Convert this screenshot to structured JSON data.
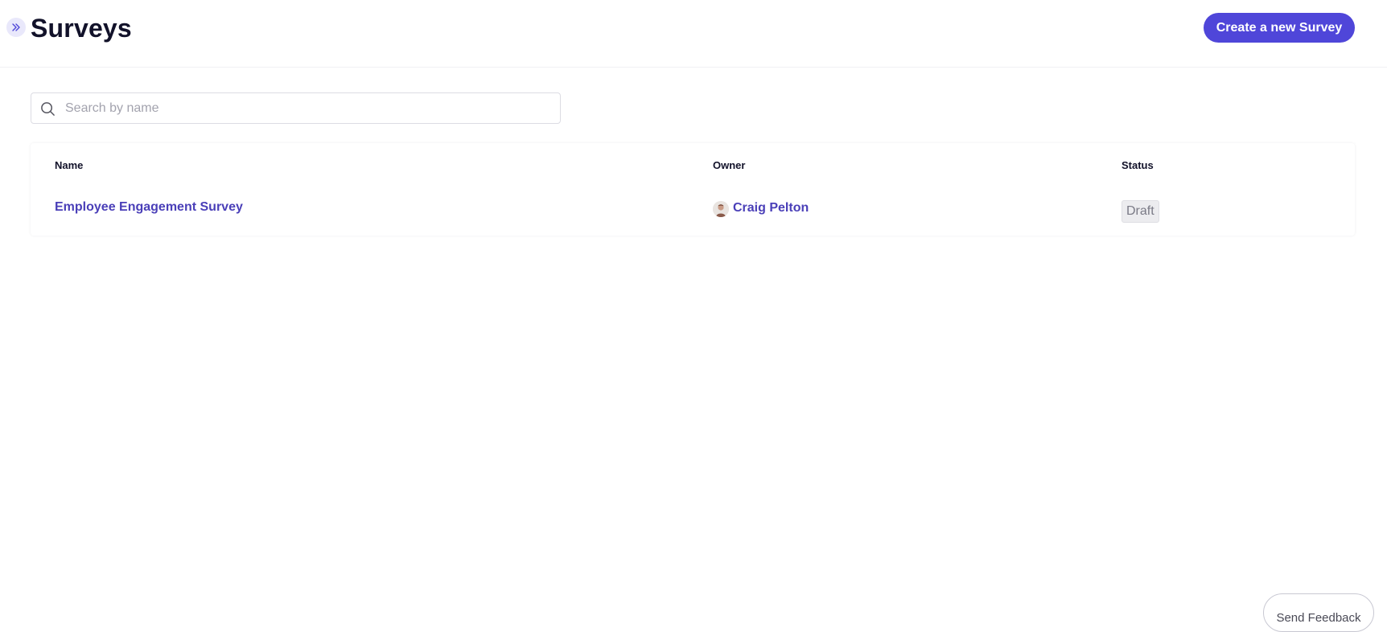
{
  "header": {
    "title": "Surveys",
    "create_button_label": "Create a new Survey",
    "sidebar_toggle_icon": "chevrons-right-icon"
  },
  "search": {
    "placeholder": "Search by name",
    "value": ""
  },
  "table": {
    "columns": {
      "name": "Name",
      "owner": "Owner",
      "status": "Status"
    },
    "rows": [
      {
        "name": "Employee Engagement Survey",
        "owner": "Craig Pelton",
        "status": "Draft"
      }
    ]
  },
  "feedback": {
    "label": "Send Feedback"
  },
  "colors": {
    "accent": "#4f46d9",
    "link": "#4a3fb8",
    "badge_bg": "#ececef"
  }
}
